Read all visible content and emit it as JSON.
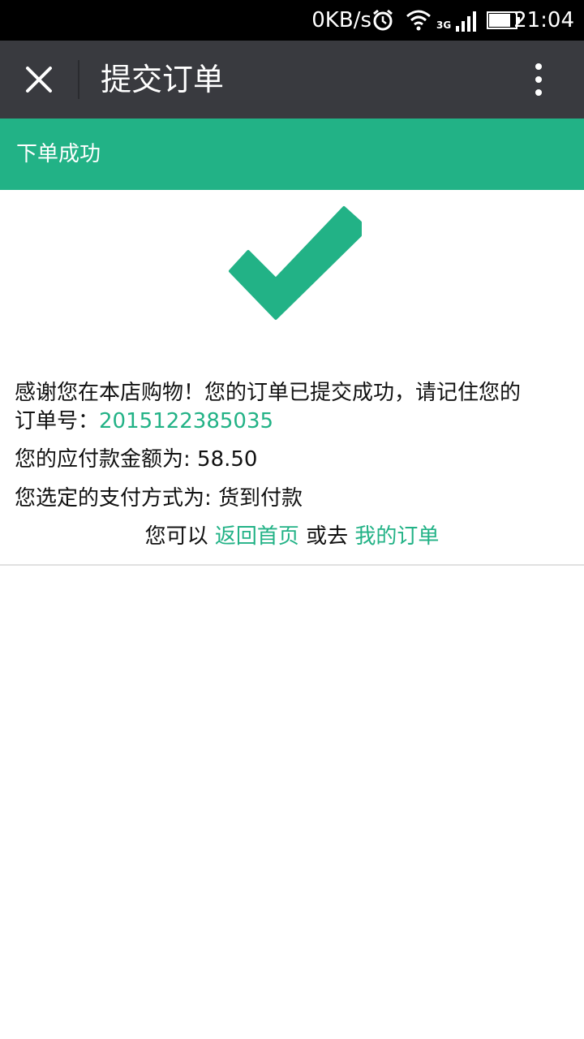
{
  "statusbar": {
    "speed": "0KB/s",
    "network": "3G",
    "time": "21:04"
  },
  "header": {
    "title": "提交订单"
  },
  "banner": {
    "text": "下单成功"
  },
  "message": {
    "line1": "感谢您在本店购物！您的订单已提交成功，请记住您的",
    "order_label": "订单号：",
    "order_number": "2015122385035",
    "amount_label": "您的应付款金额为: ",
    "amount": "58.50",
    "payment_label": "您选定的支付方式为: ",
    "payment_method": "货到付款",
    "prefix": "您可以 ",
    "home_link": "返回首页",
    "middle": " 或去 ",
    "orders_link": "我的订单"
  },
  "colors": {
    "accent": "#22b286",
    "titlebar": "#393a3f"
  },
  "icons": [
    "close-icon",
    "more-vertical-icon",
    "checkmark-icon",
    "alarm-icon",
    "wifi-icon",
    "signal-icon",
    "battery-icon"
  ]
}
